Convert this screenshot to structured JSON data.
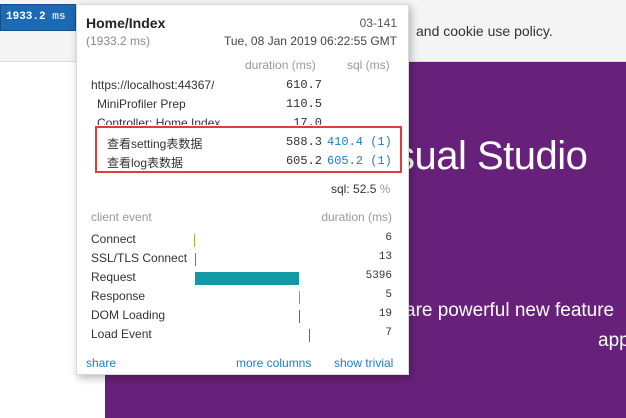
{
  "site": {
    "cookie_text": "and cookie use policy.",
    "hero_title": "sual Studio",
    "hero_sub1": "are powerful new feature",
    "hero_sub2": "app",
    "hero_color": "#68217a"
  },
  "badge": {
    "value": "1933.2",
    "unit": "ms"
  },
  "profiler": {
    "title": "Home/Index",
    "machine": "03-141",
    "total": "(1933.2 ms)",
    "date": "Tue, 08 Jan 2019 06:22:55 GMT",
    "col_duration": "duration (ms)",
    "col_sql": "sql (ms)",
    "timings": [
      {
        "name": "https://localhost:44367/",
        "duration": "610.7",
        "sql": ""
      },
      {
        "name": "MiniProfiler Prep",
        "duration": "110.5",
        "sql": ""
      },
      {
        "name": "Controller: Home.Index",
        "duration": "17.0",
        "sql": ""
      },
      {
        "name": "查看setting表数据",
        "duration": "588.3",
        "sql": "410.4 (1)"
      },
      {
        "name": "查看log表数据",
        "duration": "605.2",
        "sql": "605.2 (1)"
      }
    ],
    "sql_label": "sql:",
    "sql_value": "52.5",
    "sql_pct": "%",
    "client_event_label": "client event",
    "client_duration_label": "duration (ms)",
    "client_events": [
      {
        "name": "Connect",
        "duration": "6",
        "color": "#c9a23a"
      },
      {
        "name": "SSL/TLS Connect",
        "duration": "13",
        "color": "#7a6a9e"
      },
      {
        "name": "Request",
        "duration": "5396",
        "color": "#1399a3"
      },
      {
        "name": "Response",
        "duration": "5",
        "color": "#d9822b"
      },
      {
        "name": "DOM Loading",
        "duration": "19",
        "color": "#c8402f"
      },
      {
        "name": "Load Event",
        "duration": "7",
        "color": "#1e7fc3"
      }
    ],
    "links": {
      "share": "share",
      "more_columns": "more columns",
      "show_trivial": "show trivial"
    }
  }
}
